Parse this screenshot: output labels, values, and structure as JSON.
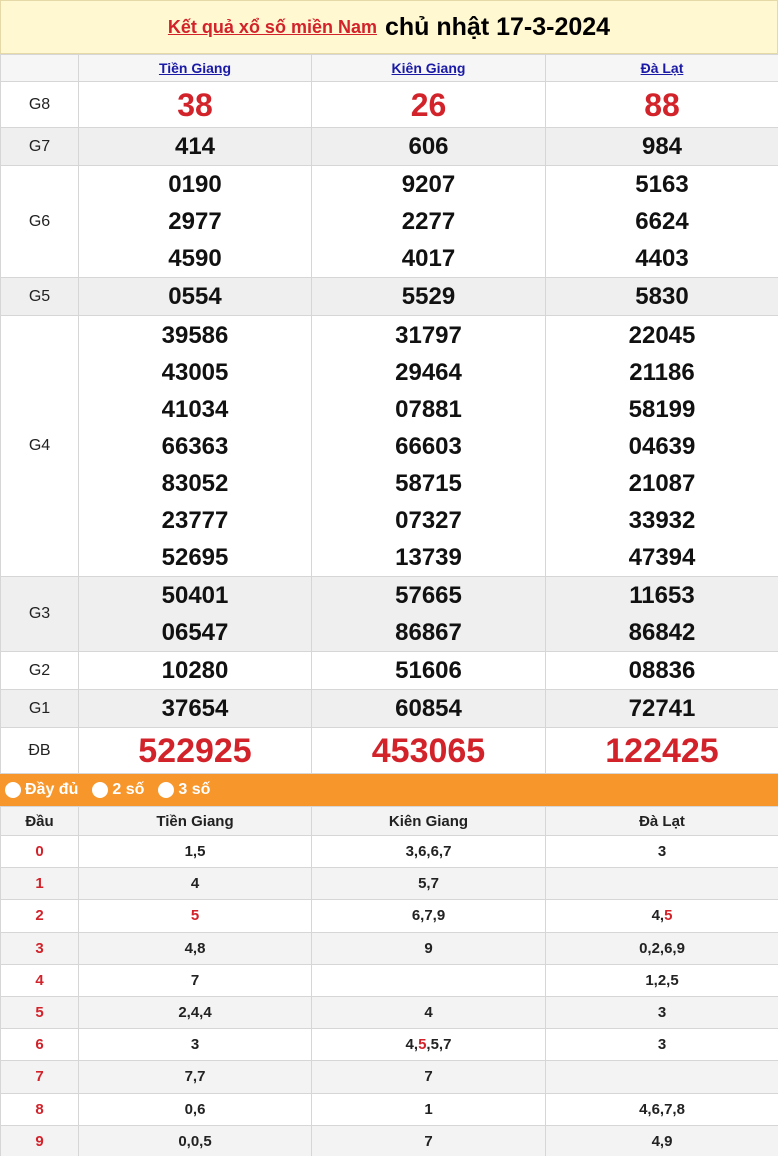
{
  "header": {
    "link_text": "Kết quả xổ số miền Nam",
    "date_text": "chủ nhật 17-3-2024"
  },
  "provinces": [
    "Tiền Giang",
    "Kiên Giang",
    "Đà Lạt"
  ],
  "prizes": [
    {
      "label": "G8",
      "values": [
        [
          "38"
        ],
        [
          "26"
        ],
        [
          "88"
        ]
      ]
    },
    {
      "label": "G7",
      "values": [
        [
          "414"
        ],
        [
          "606"
        ],
        [
          "984"
        ]
      ]
    },
    {
      "label": "G6",
      "values": [
        [
          "0190",
          "2977",
          "4590"
        ],
        [
          "9207",
          "2277",
          "4017"
        ],
        [
          "5163",
          "6624",
          "4403"
        ]
      ]
    },
    {
      "label": "G5",
      "values": [
        [
          "0554"
        ],
        [
          "5529"
        ],
        [
          "5830"
        ]
      ]
    },
    {
      "label": "G4",
      "values": [
        [
          "39586",
          "43005",
          "41034",
          "66363",
          "83052",
          "23777",
          "52695"
        ],
        [
          "31797",
          "29464",
          "07881",
          "66603",
          "58715",
          "07327",
          "13739"
        ],
        [
          "22045",
          "21186",
          "58199",
          "04639",
          "21087",
          "33932",
          "47394"
        ]
      ]
    },
    {
      "label": "G3",
      "values": [
        [
          "50401",
          "06547"
        ],
        [
          "57665",
          "86867"
        ],
        [
          "11653",
          "86842"
        ]
      ]
    },
    {
      "label": "G2",
      "values": [
        [
          "10280"
        ],
        [
          "51606"
        ],
        [
          "08836"
        ]
      ]
    },
    {
      "label": "G1",
      "values": [
        [
          "37654"
        ],
        [
          "60854"
        ],
        [
          "72741"
        ]
      ]
    },
    {
      "label": "ĐB",
      "values": [
        [
          "522925"
        ],
        [
          "453065"
        ],
        [
          "122425"
        ]
      ]
    }
  ],
  "options": [
    "Đầy đủ",
    "2 số",
    "3 số"
  ],
  "head_table": {
    "head_label": "Đầu",
    "rows": [
      {
        "digit": "0",
        "cells": [
          [
            {
              "t": "1,5",
              "r": false
            }
          ],
          [
            {
              "t": "3,6,6,7",
              "r": false
            }
          ],
          [
            {
              "t": "3",
              "r": false
            }
          ]
        ]
      },
      {
        "digit": "1",
        "cells": [
          [
            {
              "t": "4",
              "r": false
            }
          ],
          [
            {
              "t": "5,7",
              "r": false
            }
          ],
          []
        ]
      },
      {
        "digit": "2",
        "cells": [
          [
            {
              "t": "5",
              "r": true
            }
          ],
          [
            {
              "t": "6,7,9",
              "r": false
            }
          ],
          [
            {
              "t": "4,",
              "r": false
            },
            {
              "t": "5",
              "r": true
            }
          ]
        ]
      },
      {
        "digit": "3",
        "cells": [
          [
            {
              "t": "4,8",
              "r": false
            }
          ],
          [
            {
              "t": "9",
              "r": false
            }
          ],
          [
            {
              "t": "0,2,6,9",
              "r": false
            }
          ]
        ]
      },
      {
        "digit": "4",
        "cells": [
          [
            {
              "t": "7",
              "r": false
            }
          ],
          [],
          [
            {
              "t": "1,2,5",
              "r": false
            }
          ]
        ]
      },
      {
        "digit": "5",
        "cells": [
          [
            {
              "t": "2,4,4",
              "r": false
            }
          ],
          [
            {
              "t": "4",
              "r": false
            }
          ],
          [
            {
              "t": "3",
              "r": false
            }
          ]
        ]
      },
      {
        "digit": "6",
        "cells": [
          [
            {
              "t": "3",
              "r": false
            }
          ],
          [
            {
              "t": "4,",
              "r": false
            },
            {
              "t": "5",
              "r": true
            },
            {
              "t": ",5,7",
              "r": false
            }
          ],
          [
            {
              "t": "3",
              "r": false
            }
          ]
        ]
      },
      {
        "digit": "7",
        "cells": [
          [
            {
              "t": "7,7",
              "r": false
            }
          ],
          [
            {
              "t": "7",
              "r": false
            }
          ],
          []
        ]
      },
      {
        "digit": "8",
        "cells": [
          [
            {
              "t": "0,6",
              "r": false
            }
          ],
          [
            {
              "t": "1",
              "r": false
            }
          ],
          [
            {
              "t": "4,6,7,8",
              "r": false
            }
          ]
        ]
      },
      {
        "digit": "9",
        "cells": [
          [
            {
              "t": "0,0,5",
              "r": false
            }
          ],
          [
            {
              "t": "7",
              "r": false
            }
          ],
          [
            {
              "t": "4,9",
              "r": false
            }
          ]
        ]
      }
    ]
  },
  "colors": {
    "red": "#d2222a",
    "orange": "#f7962b",
    "title_bg": "#fff8d0",
    "link_blue": "#1a1aa6"
  }
}
